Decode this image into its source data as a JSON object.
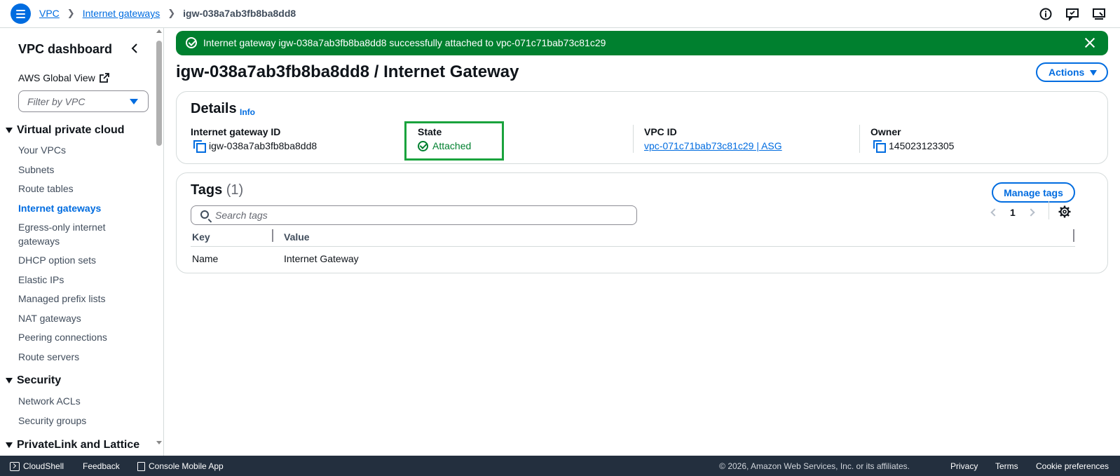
{
  "breadcrumb": {
    "vpc": "VPC",
    "internet_gateways": "Internet gateways",
    "current": "igw-038a7ab3fb8ba8dd8"
  },
  "sidebar": {
    "title": "VPC dashboard",
    "global_view": "AWS Global View",
    "filter_placeholder": "Filter by VPC",
    "sections": {
      "vpc": "Virtual private cloud",
      "security": "Security",
      "privatelink": "PrivateLink and Lattice"
    },
    "items": {
      "your_vpcs": "Your VPCs",
      "subnets": "Subnets",
      "route_tables": "Route tables",
      "internet_gateways": "Internet gateways",
      "egress_only": "Egress-only internet gateways",
      "dhcp": "DHCP option sets",
      "elastic_ips": "Elastic IPs",
      "prefix_lists": "Managed prefix lists",
      "nat": "NAT gateways",
      "peering": "Peering connections",
      "route_servers": "Route servers",
      "nacls": "Network ACLs",
      "security_groups": "Security groups"
    }
  },
  "flash": {
    "message": "Internet gateway igw-038a7ab3fb8ba8dd8 successfully attached to vpc-071c71bab73c81c29"
  },
  "page": {
    "title": "igw-038a7ab3fb8ba8dd8 / Internet Gateway",
    "actions_label": "Actions"
  },
  "details": {
    "heading": "Details",
    "info": "Info",
    "igw_label": "Internet gateway ID",
    "igw_value": "igw-038a7ab3fb8ba8dd8",
    "state_label": "State",
    "state_value": "Attached",
    "vpc_label": "VPC ID",
    "vpc_value": "vpc-071c71bab73c81c29 | ASG",
    "owner_label": "Owner",
    "owner_value": "145023123305"
  },
  "tags": {
    "heading": "Tags",
    "count": "(1)",
    "manage_label": "Manage tags",
    "search_placeholder": "Search tags",
    "page_number": "1",
    "columns": [
      "Key",
      "Value"
    ],
    "rows": [
      {
        "key": "Name",
        "value": "Internet Gateway"
      }
    ]
  },
  "footer": {
    "cloudshell": "CloudShell",
    "feedback": "Feedback",
    "mobile_app": "Console Mobile App",
    "copyright": "© 2026, Amazon Web Services, Inc. or its affiliates.",
    "privacy": "Privacy",
    "terms": "Terms",
    "cookies": "Cookie preferences"
  },
  "colors": {
    "link": "#006ce0",
    "success": "#00802f",
    "footer_bg": "#232f3e",
    "highlight_border": "#1aa33d"
  }
}
